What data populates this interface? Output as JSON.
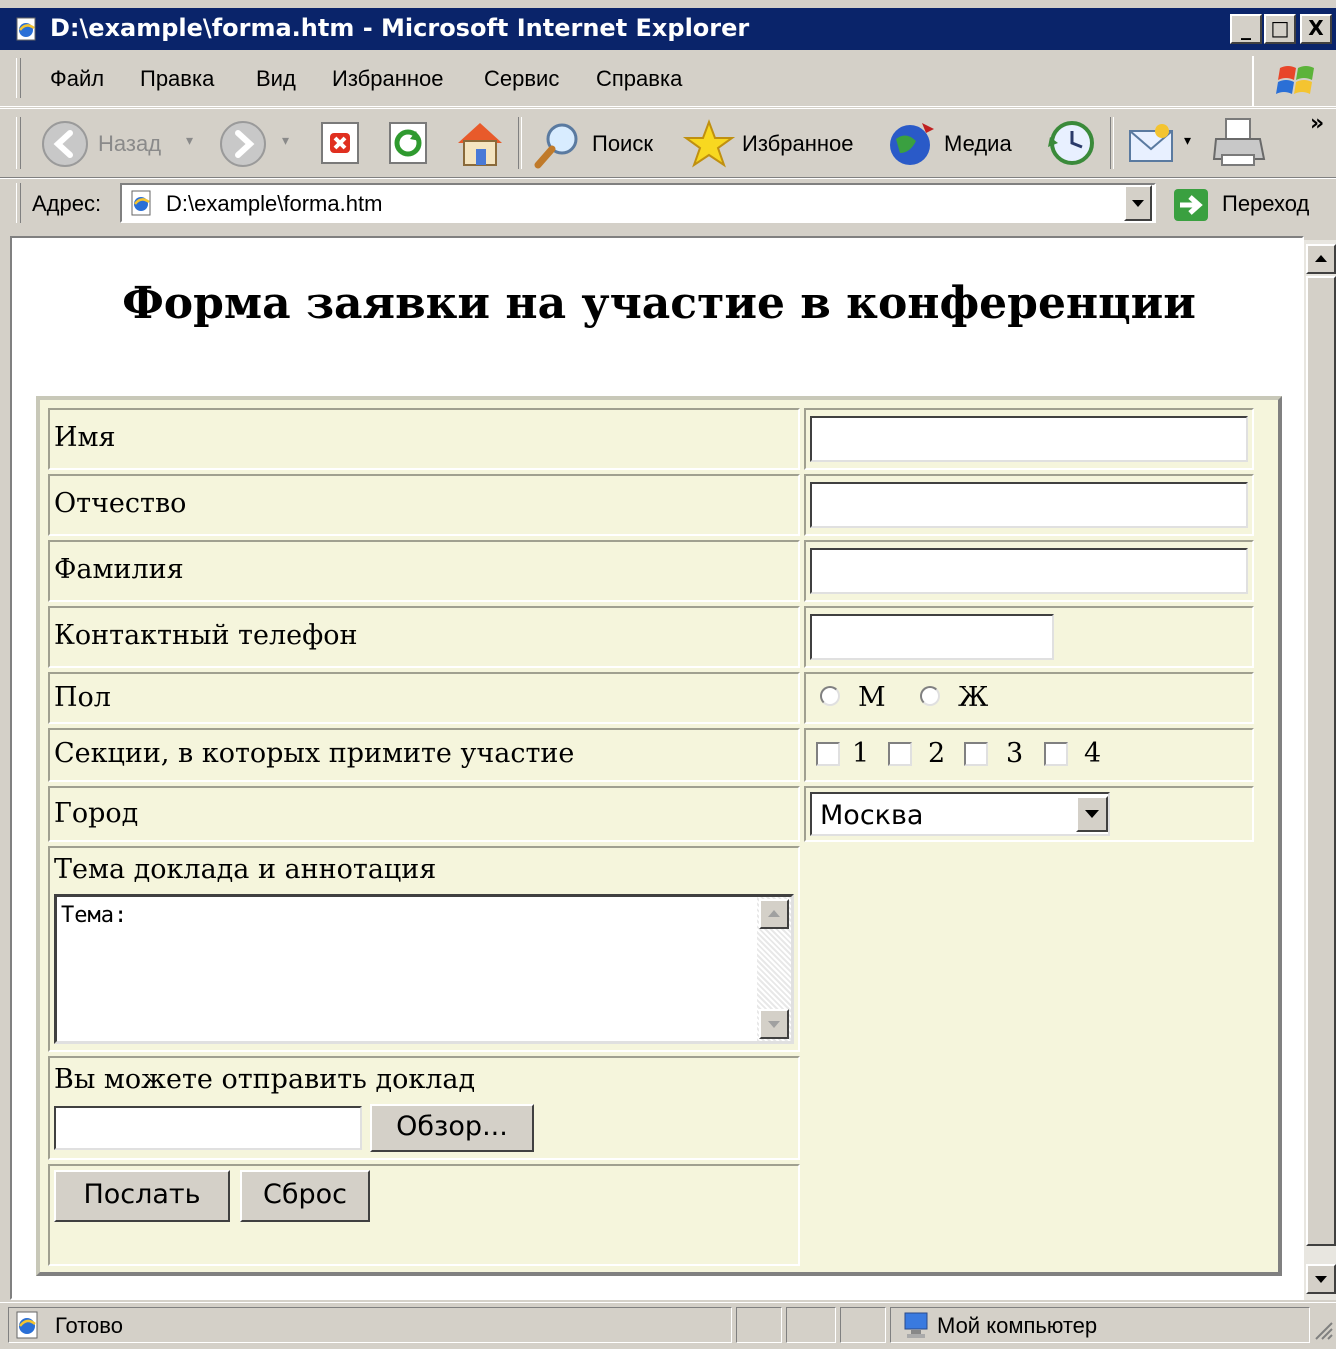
{
  "window": {
    "title": "D:\\example\\forma.htm - Microsoft Internet Explorer",
    "minimize": "_",
    "maximize": "□",
    "close": "X"
  },
  "menu": [
    "Файл",
    "Правка",
    "Вид",
    "Избранное",
    "Сервис",
    "Справка"
  ],
  "toolbar": {
    "back": "Назад",
    "search": "Поиск",
    "favorites": "Избранное",
    "media": "Медиа",
    "more": "»"
  },
  "address": {
    "label": "Адрес:",
    "value": "D:\\example\\forma.htm",
    "go": "Переход"
  },
  "page": {
    "heading": "Форма заявки на участие в конференции",
    "fields": {
      "name": "Имя",
      "patronymic": "Отчество",
      "surname": "Фамилия",
      "phone": "Контактный телефон",
      "gender": "Пол",
      "sections": "Секции, в которых примите участие",
      "city": "Город",
      "topic": "Тема доклада и аннотация",
      "upload": "Вы можете отправить доклад"
    },
    "gender_options": [
      "М",
      "Ж"
    ],
    "section_options": [
      "1",
      "2",
      "3",
      "4"
    ],
    "city_selected": "Москва",
    "topic_value": "Тема:",
    "browse_button": "Обзор...",
    "submit_button": "Послать",
    "reset_button": "Сброс"
  },
  "status": {
    "text": "Готово",
    "zone": "Мой компьютер"
  }
}
